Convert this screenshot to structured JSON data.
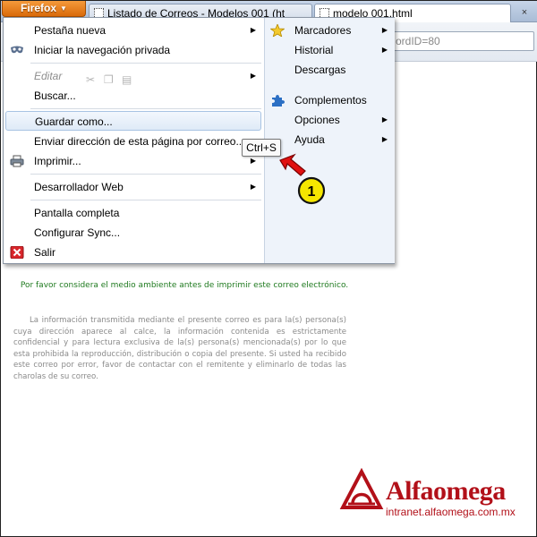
{
  "browser": {
    "button_label": "Firefox",
    "tabs": [
      {
        "label": "Listado de Correos - Modelos 001 (ht"
      },
      {
        "label": "modelo 001.html"
      }
    ],
    "close_glyph": "×",
    "url_fragment": "ordID=80"
  },
  "menu": {
    "left": [
      {
        "label": "Pestaña nueva",
        "submenu": true
      },
      {
        "label": "Iniciar la navegación privada",
        "submenu": false
      },
      {
        "label": "Editar",
        "submenu": true,
        "disabled": true
      },
      {
        "label": "Buscar...",
        "submenu": false
      },
      {
        "label": "Guardar como...",
        "submenu": false,
        "highlighted": true
      },
      {
        "label": "Enviar dirección de esta página por correo...",
        "submenu": false
      },
      {
        "label": "Imprimir...",
        "submenu": true
      },
      {
        "label": "Desarrollador Web",
        "submenu": true
      },
      {
        "label": "Pantalla completa",
        "submenu": false
      },
      {
        "label": "Configurar Sync...",
        "submenu": false
      },
      {
        "label": "Salir",
        "submenu": false
      }
    ],
    "right": [
      {
        "label": "Marcadores",
        "submenu": true
      },
      {
        "label": "Historial",
        "submenu": true
      },
      {
        "label": "Descargas",
        "submenu": false
      },
      {
        "label": "Complementos",
        "submenu": false
      },
      {
        "label": "Opciones",
        "submenu": true
      },
      {
        "label": "Ayuda",
        "submenu": true
      }
    ],
    "submenu_glyph": "▶"
  },
  "tooltip": {
    "shortcut": "Ctrl+S"
  },
  "callout": {
    "number": "1"
  },
  "content": {
    "green_notice": "Por favor considera el medio ambiente antes de imprimir este correo electrónico.",
    "disclaimer": "La información transmitida mediante el presente correo es para la(s) persona(s) cuya dirección aparece al calce, la información contenida es estrictamente confidencial y para lectura exclusiva de la(s) persona(s) mencionada(s) por lo que esta prohibida la reproducción, distribución o copia del presente. Si usted ha recibido este correo por error, favor de contactar con el remitente y eliminarlo de todas las charolas de su correo."
  },
  "logo": {
    "name": "Alfaomega",
    "url": "intranet.alfaomega.com.mx",
    "color": "#b21019"
  },
  "colors": {
    "firefox_orange": "#e07a1c",
    "callout_yellow": "#f5e600",
    "arrow_red": "#e01010",
    "notice_green": "#1f7a1f"
  }
}
